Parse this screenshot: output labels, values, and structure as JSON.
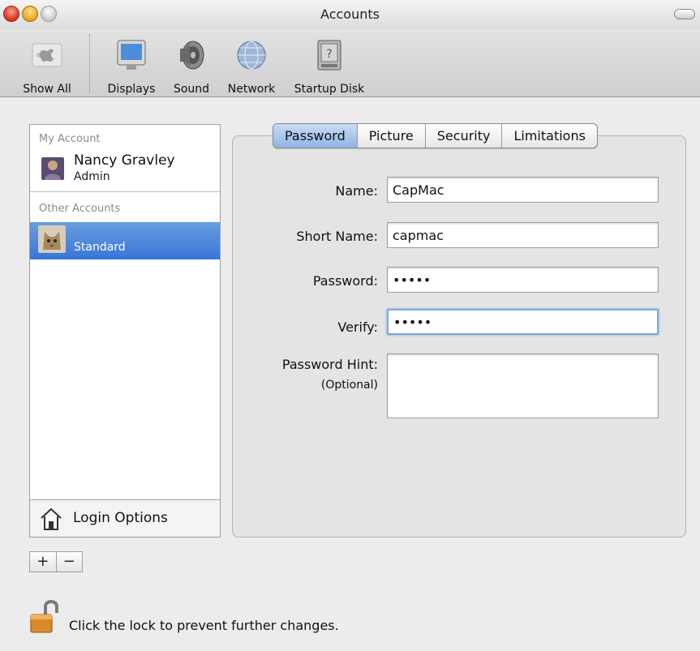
{
  "window": {
    "title": "Accounts"
  },
  "toolbar": {
    "items": [
      {
        "label": "Show All",
        "icon": "apple-grid-icon"
      },
      {
        "label": "Displays",
        "icon": "display-icon"
      },
      {
        "label": "Sound",
        "icon": "speaker-icon"
      },
      {
        "label": "Network",
        "icon": "globe-icon"
      },
      {
        "label": "Startup Disk",
        "icon": "disk-icon"
      }
    ]
  },
  "sidebar": {
    "my_account_title": "My Account",
    "my_account": {
      "name": "Nancy Gravley",
      "role": "Admin"
    },
    "other_accounts_title": "Other Accounts",
    "other_accounts": [
      {
        "name": "",
        "role": "Standard"
      }
    ],
    "login_options_label": "Login Options",
    "add_label": "+",
    "remove_label": "−"
  },
  "tabs": [
    {
      "label": "Password",
      "active": true
    },
    {
      "label": "Picture",
      "active": false
    },
    {
      "label": "Security",
      "active": false
    },
    {
      "label": "Limitations",
      "active": false
    }
  ],
  "form": {
    "name_label": "Name:",
    "name_value": "CapMac",
    "short_name_label": "Short Name:",
    "short_name_value": "capmac",
    "password_label": "Password:",
    "password_value": "•••••",
    "verify_label": "Verify:",
    "verify_value": "•••••",
    "hint_label": "Password Hint:",
    "hint_optional": "(Optional)",
    "hint_value": ""
  },
  "lock": {
    "text": "Click the lock to prevent further changes."
  },
  "colors": {
    "selection": "#3875d7",
    "tab_active": "#8fb4e6"
  }
}
